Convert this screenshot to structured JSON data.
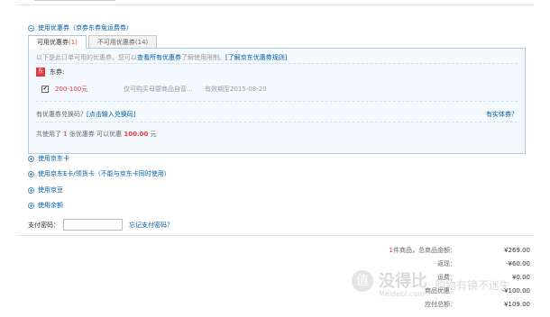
{
  "coupon_section": {
    "toggle_label": "使用优惠券（京券东券免运费券）",
    "tabs": [
      {
        "label": "可用优惠券",
        "count": "(1)"
      },
      {
        "label": "不可用优惠券",
        "count": "(14)"
      }
    ],
    "hint": "以下是此订单可用的优惠券，您可以",
    "hint_link1": "查看所有优惠券",
    "hint_mid": "了解使用限制。",
    "hint_link2": "[了解京东优惠券规则]",
    "group_label": "东券:",
    "group_icon": "东",
    "coupon": {
      "checked": true,
      "check_glyph": "✔",
      "amount": "200-100元",
      "scope": "仅可购买母婴商品自营...",
      "expiry": "有效期至2015-08-20"
    },
    "exchange_label": "有优惠券兑换码？",
    "exchange_link": "[点击输入兑换码]",
    "physical_link": "有实体券？",
    "summary_prefix": "共使用了",
    "summary_count": "1",
    "summary_mid": "张优惠券   可以优惠",
    "summary_amount": "100.00",
    "summary_suffix": "元"
  },
  "other_options": [
    {
      "label": "使用京东卡"
    },
    {
      "label": "使用京东E卡/领货卡（不能与京东卡同时使用）"
    },
    {
      "label": "使用京豆"
    },
    {
      "label": "使用余额"
    }
  ],
  "payment": {
    "label": "支付密码：",
    "input_value": "",
    "forgot_link": "忘记支付密码？"
  },
  "totals": {
    "items_count": "1",
    "items_label": "件商品，总商品金额：",
    "items_value": "¥269.00",
    "cashback_label": "返现：",
    "cashback_value": "-¥60.00",
    "shipping_label": "运费：",
    "shipping_value": "¥0.00",
    "discount_label": "商品优惠：",
    "discount_value": "-¥100.00",
    "total_label": "应付总额：",
    "total_value": "¥109.00"
  },
  "watermark": {
    "circle": "值",
    "big": "没得比",
    "slogan": "购物有镜不迷失",
    "domain": "Meidebi.com"
  }
}
